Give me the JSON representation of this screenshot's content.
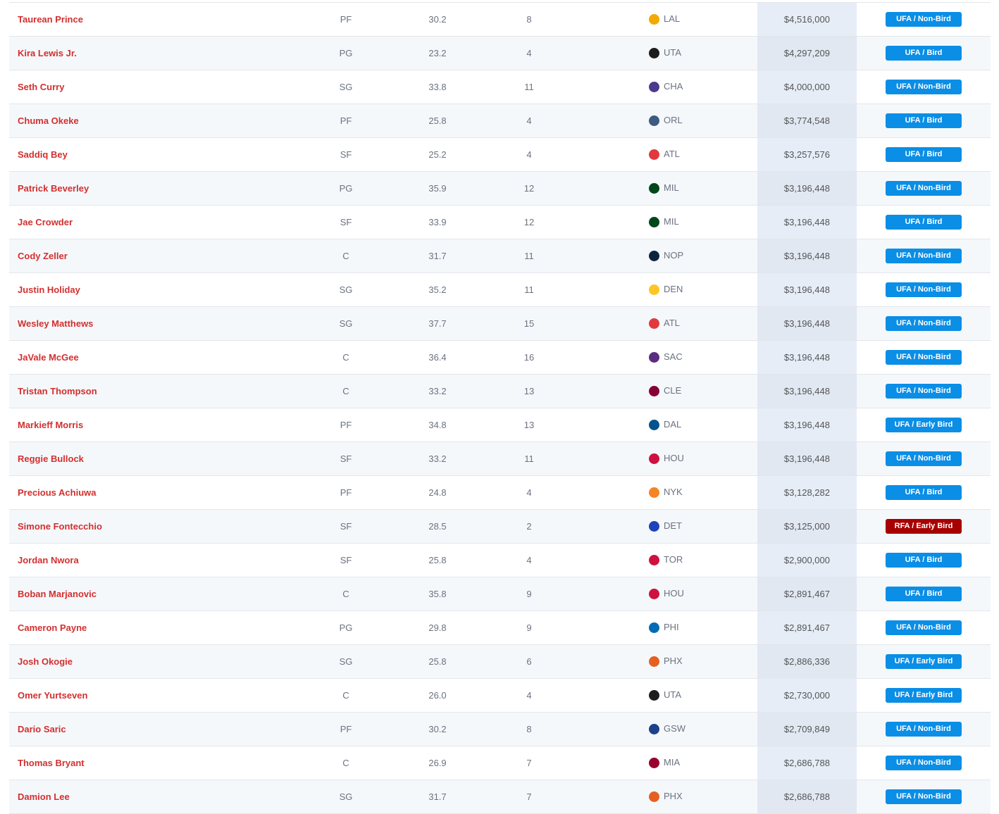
{
  "colors": {
    "name": "#d32f2f",
    "ufa": "#0a8ee6",
    "rfa": "#a80000"
  },
  "rows": [
    {
      "name": "Taurean Prince",
      "pos": "PF",
      "age": "30.2",
      "exp": "8",
      "team": "LAL",
      "logo": "#f2a900",
      "salary": "$4,516,000",
      "status": "UFA / Non-Bird",
      "type": "ufa"
    },
    {
      "name": "Kira Lewis Jr.",
      "pos": "PG",
      "age": "23.2",
      "exp": "4",
      "team": "UTA",
      "logo": "#1d1d1d",
      "salary": "$4,297,209",
      "status": "UFA / Bird",
      "type": "ufa"
    },
    {
      "name": "Seth Curry",
      "pos": "SG",
      "age": "33.8",
      "exp": "11",
      "team": "CHA",
      "logo": "#4b3a8c",
      "salary": "$4,000,000",
      "status": "UFA / Non-Bird",
      "type": "ufa"
    },
    {
      "name": "Chuma Okeke",
      "pos": "PF",
      "age": "25.8",
      "exp": "4",
      "team": "ORL",
      "logo": "#3d5a80",
      "salary": "$3,774,548",
      "status": "UFA / Bird",
      "type": "ufa"
    },
    {
      "name": "Saddiq Bey",
      "pos": "SF",
      "age": "25.2",
      "exp": "4",
      "team": "ATL",
      "logo": "#e03a3e",
      "salary": "$3,257,576",
      "status": "UFA / Bird",
      "type": "ufa"
    },
    {
      "name": "Patrick Beverley",
      "pos": "PG",
      "age": "35.9",
      "exp": "12",
      "team": "MIL",
      "logo": "#00471b",
      "salary": "$3,196,448",
      "status": "UFA / Non-Bird",
      "type": "ufa"
    },
    {
      "name": "Jae Crowder",
      "pos": "SF",
      "age": "33.9",
      "exp": "12",
      "team": "MIL",
      "logo": "#00471b",
      "salary": "$3,196,448",
      "status": "UFA / Bird",
      "type": "ufa"
    },
    {
      "name": "Cody Zeller",
      "pos": "C",
      "age": "31.7",
      "exp": "11",
      "team": "NOP",
      "logo": "#0c2340",
      "salary": "$3,196,448",
      "status": "UFA / Non-Bird",
      "type": "ufa"
    },
    {
      "name": "Justin Holiday",
      "pos": "SG",
      "age": "35.2",
      "exp": "11",
      "team": "DEN",
      "logo": "#fec524",
      "salary": "$3,196,448",
      "status": "UFA / Non-Bird",
      "type": "ufa"
    },
    {
      "name": "Wesley Matthews",
      "pos": "SG",
      "age": "37.7",
      "exp": "15",
      "team": "ATL",
      "logo": "#e03a3e",
      "salary": "$3,196,448",
      "status": "UFA / Non-Bird",
      "type": "ufa"
    },
    {
      "name": "JaVale McGee",
      "pos": "C",
      "age": "36.4",
      "exp": "16",
      "team": "SAC",
      "logo": "#5a2d81",
      "salary": "$3,196,448",
      "status": "UFA / Non-Bird",
      "type": "ufa"
    },
    {
      "name": "Tristan Thompson",
      "pos": "C",
      "age": "33.2",
      "exp": "13",
      "team": "CLE",
      "logo": "#860038",
      "salary": "$3,196,448",
      "status": "UFA / Non-Bird",
      "type": "ufa"
    },
    {
      "name": "Markieff Morris",
      "pos": "PF",
      "age": "34.8",
      "exp": "13",
      "team": "DAL",
      "logo": "#00538c",
      "salary": "$3,196,448",
      "status": "UFA / Early Bird",
      "type": "ufa"
    },
    {
      "name": "Reggie Bullock",
      "pos": "SF",
      "age": "33.2",
      "exp": "11",
      "team": "HOU",
      "logo": "#ce1141",
      "salary": "$3,196,448",
      "status": "UFA / Non-Bird",
      "type": "ufa"
    },
    {
      "name": "Precious Achiuwa",
      "pos": "PF",
      "age": "24.8",
      "exp": "4",
      "team": "NYK",
      "logo": "#f58426",
      "salary": "$3,128,282",
      "status": "UFA / Bird",
      "type": "ufa"
    },
    {
      "name": "Simone Fontecchio",
      "pos": "SF",
      "age": "28.5",
      "exp": "2",
      "team": "DET",
      "logo": "#1d42ba",
      "salary": "$3,125,000",
      "status": "RFA / Early Bird",
      "type": "rfa"
    },
    {
      "name": "Jordan Nwora",
      "pos": "SF",
      "age": "25.8",
      "exp": "4",
      "team": "TOR",
      "logo": "#ce1141",
      "salary": "$2,900,000",
      "status": "UFA / Bird",
      "type": "ufa"
    },
    {
      "name": "Boban Marjanovic",
      "pos": "C",
      "age": "35.8",
      "exp": "9",
      "team": "HOU",
      "logo": "#ce1141",
      "salary": "$2,891,467",
      "status": "UFA / Bird",
      "type": "ufa"
    },
    {
      "name": "Cameron Payne",
      "pos": "PG",
      "age": "29.8",
      "exp": "9",
      "team": "PHI",
      "logo": "#006bb6",
      "salary": "$2,891,467",
      "status": "UFA / Non-Bird",
      "type": "ufa"
    },
    {
      "name": "Josh Okogie",
      "pos": "SG",
      "age": "25.8",
      "exp": "6",
      "team": "PHX",
      "logo": "#e56020",
      "salary": "$2,886,336",
      "status": "UFA / Early Bird",
      "type": "ufa"
    },
    {
      "name": "Omer Yurtseven",
      "pos": "C",
      "age": "26.0",
      "exp": "4",
      "team": "UTA",
      "logo": "#1d1d1d",
      "salary": "$2,730,000",
      "status": "UFA / Early Bird",
      "type": "ufa"
    },
    {
      "name": "Dario Saric",
      "pos": "PF",
      "age": "30.2",
      "exp": "8",
      "team": "GSW",
      "logo": "#1d428a",
      "salary": "$2,709,849",
      "status": "UFA / Non-Bird",
      "type": "ufa"
    },
    {
      "name": "Thomas Bryant",
      "pos": "C",
      "age": "26.9",
      "exp": "7",
      "team": "MIA",
      "logo": "#98002e",
      "salary": "$2,686,788",
      "status": "UFA / Non-Bird",
      "type": "ufa"
    },
    {
      "name": "Damion Lee",
      "pos": "SG",
      "age": "31.7",
      "exp": "7",
      "team": "PHX",
      "logo": "#e56020",
      "salary": "$2,686,788",
      "status": "UFA / Non-Bird",
      "type": "ufa"
    }
  ]
}
